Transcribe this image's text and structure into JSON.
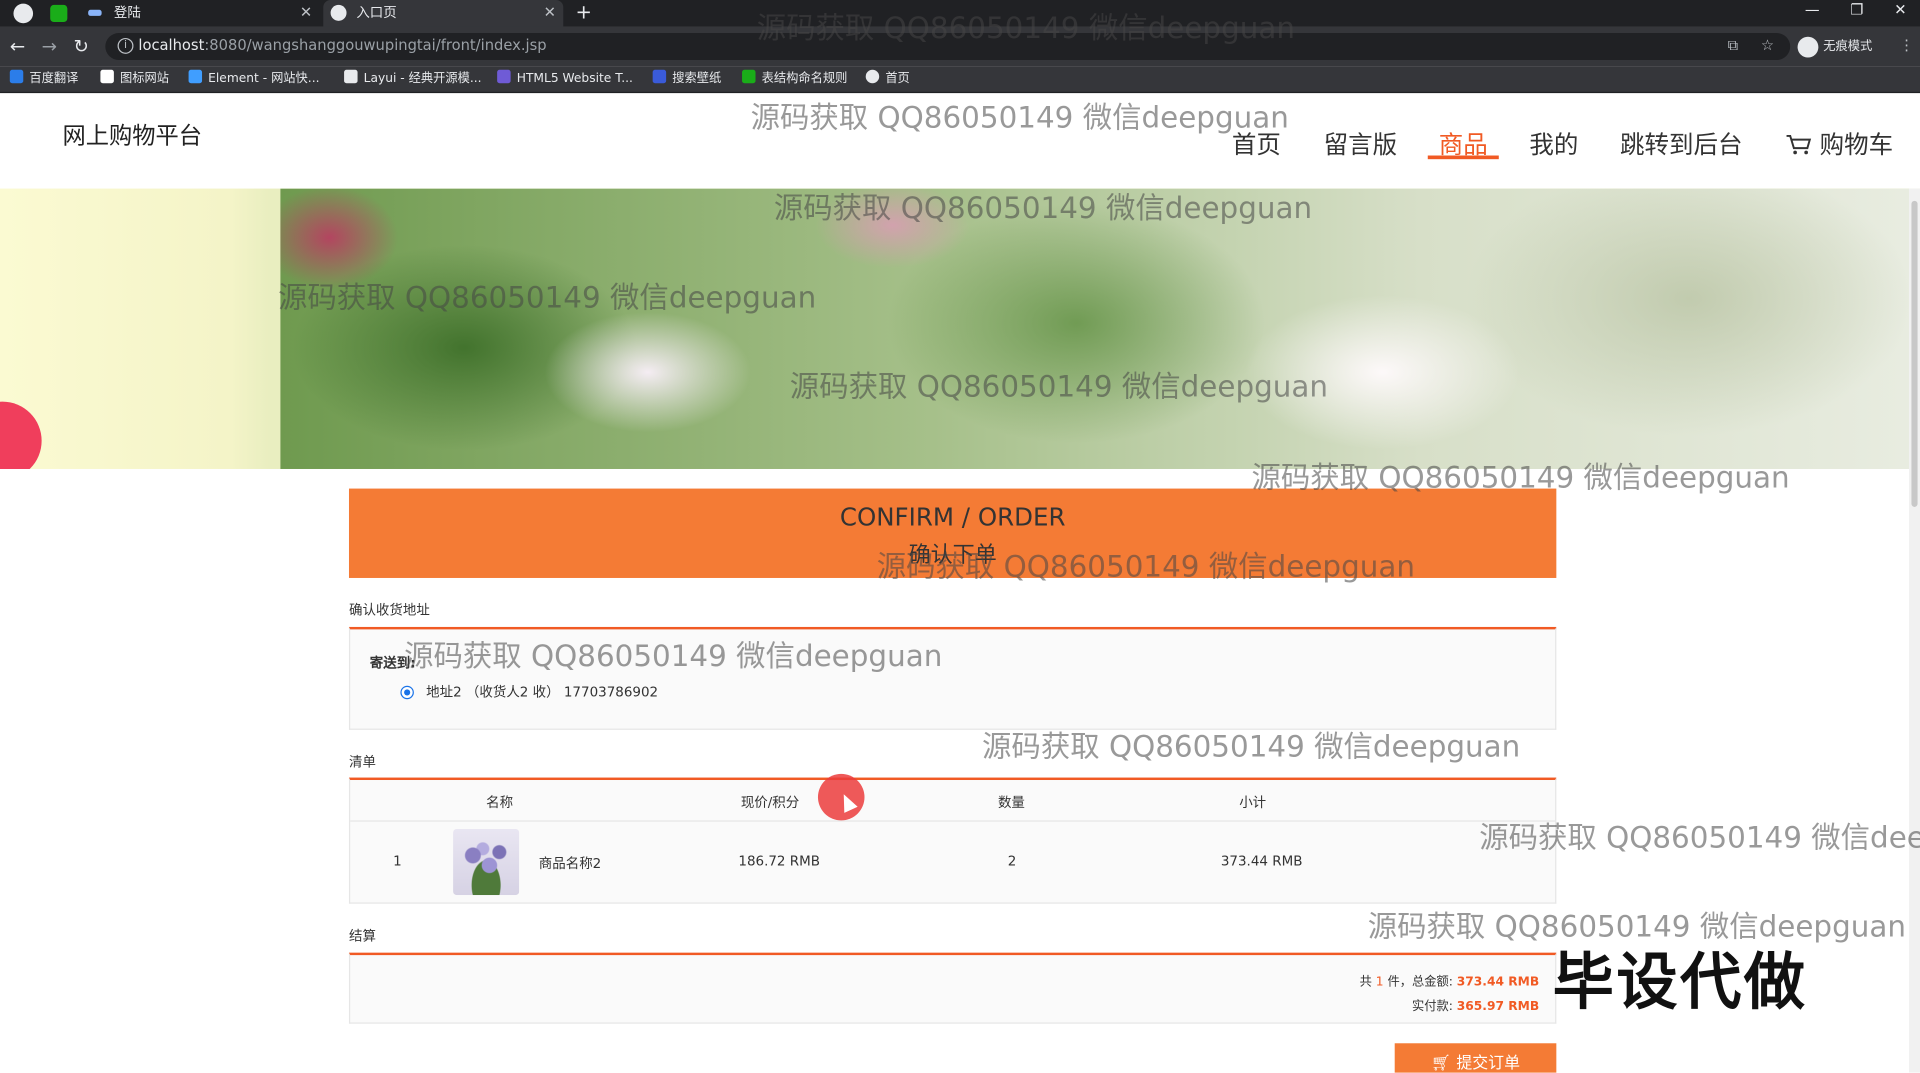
{
  "browser": {
    "tabs": [
      {
        "label": ""
      },
      {
        "label": "登陆"
      },
      {
        "label": "入口页"
      }
    ],
    "url_host": "localhost",
    "url_path": ":8080/wangshanggouwupingtai/front/index.jsp",
    "profile_label": "无痕模式",
    "bookmarks": [
      {
        "label": "百度翻译",
        "color": "#2b7de9"
      },
      {
        "label": "图标网站",
        "color": "#ffffff"
      },
      {
        "label": "Element - 网站快...",
        "color": "#409eff"
      },
      {
        "label": "Layui - 经典开源模...",
        "color": "#e8eaed"
      },
      {
        "label": "HTML5 Website T...",
        "color": "#6f5bd6"
      },
      {
        "label": "搜索壁纸",
        "color": "#3a5bd9"
      },
      {
        "label": "表结构命名规则",
        "color": "#1aad19"
      },
      {
        "label": "首页",
        "color": "#e8eaed"
      }
    ]
  },
  "site": {
    "title": "网上购物平台",
    "nav": [
      {
        "label": "首页"
      },
      {
        "label": "留言版"
      },
      {
        "label": "商品"
      },
      {
        "label": "我的"
      },
      {
        "label": "跳转到后台"
      },
      {
        "label": "购物车"
      }
    ],
    "active_nav": "商品",
    "accent_color": "#f15a24"
  },
  "order": {
    "header_en": "CONFIRM / ORDER",
    "header_zh": "确认下单",
    "address_section_label": "确认收货地址",
    "ship_to_label": "寄送到:",
    "address_text": "地址2 （收货人2 收） 17703786902",
    "list_section_label": "清单",
    "columns": [
      "名称",
      "现价/积分",
      "数量",
      "小计"
    ],
    "rows": [
      {
        "index": "1",
        "name": "商品名称2",
        "price": "186.72 RMB",
        "quantity": "2",
        "subtotal": "373.44 RMB"
      }
    ],
    "settle_section_label": "结算",
    "summary_prefix": "共",
    "item_count": "1",
    "summary_mid": "件，总金额:",
    "total_amount": "373.44 RMB",
    "paid_label": "实付款:",
    "paid_amount": "365.97 RMB",
    "submit_label": "提交订单"
  },
  "watermarks": {
    "text": "源码获取 QQ86050149 微信deepguan",
    "partial": "源码获取 QQ86050149 微信dee",
    "promo": "毕设代做"
  }
}
